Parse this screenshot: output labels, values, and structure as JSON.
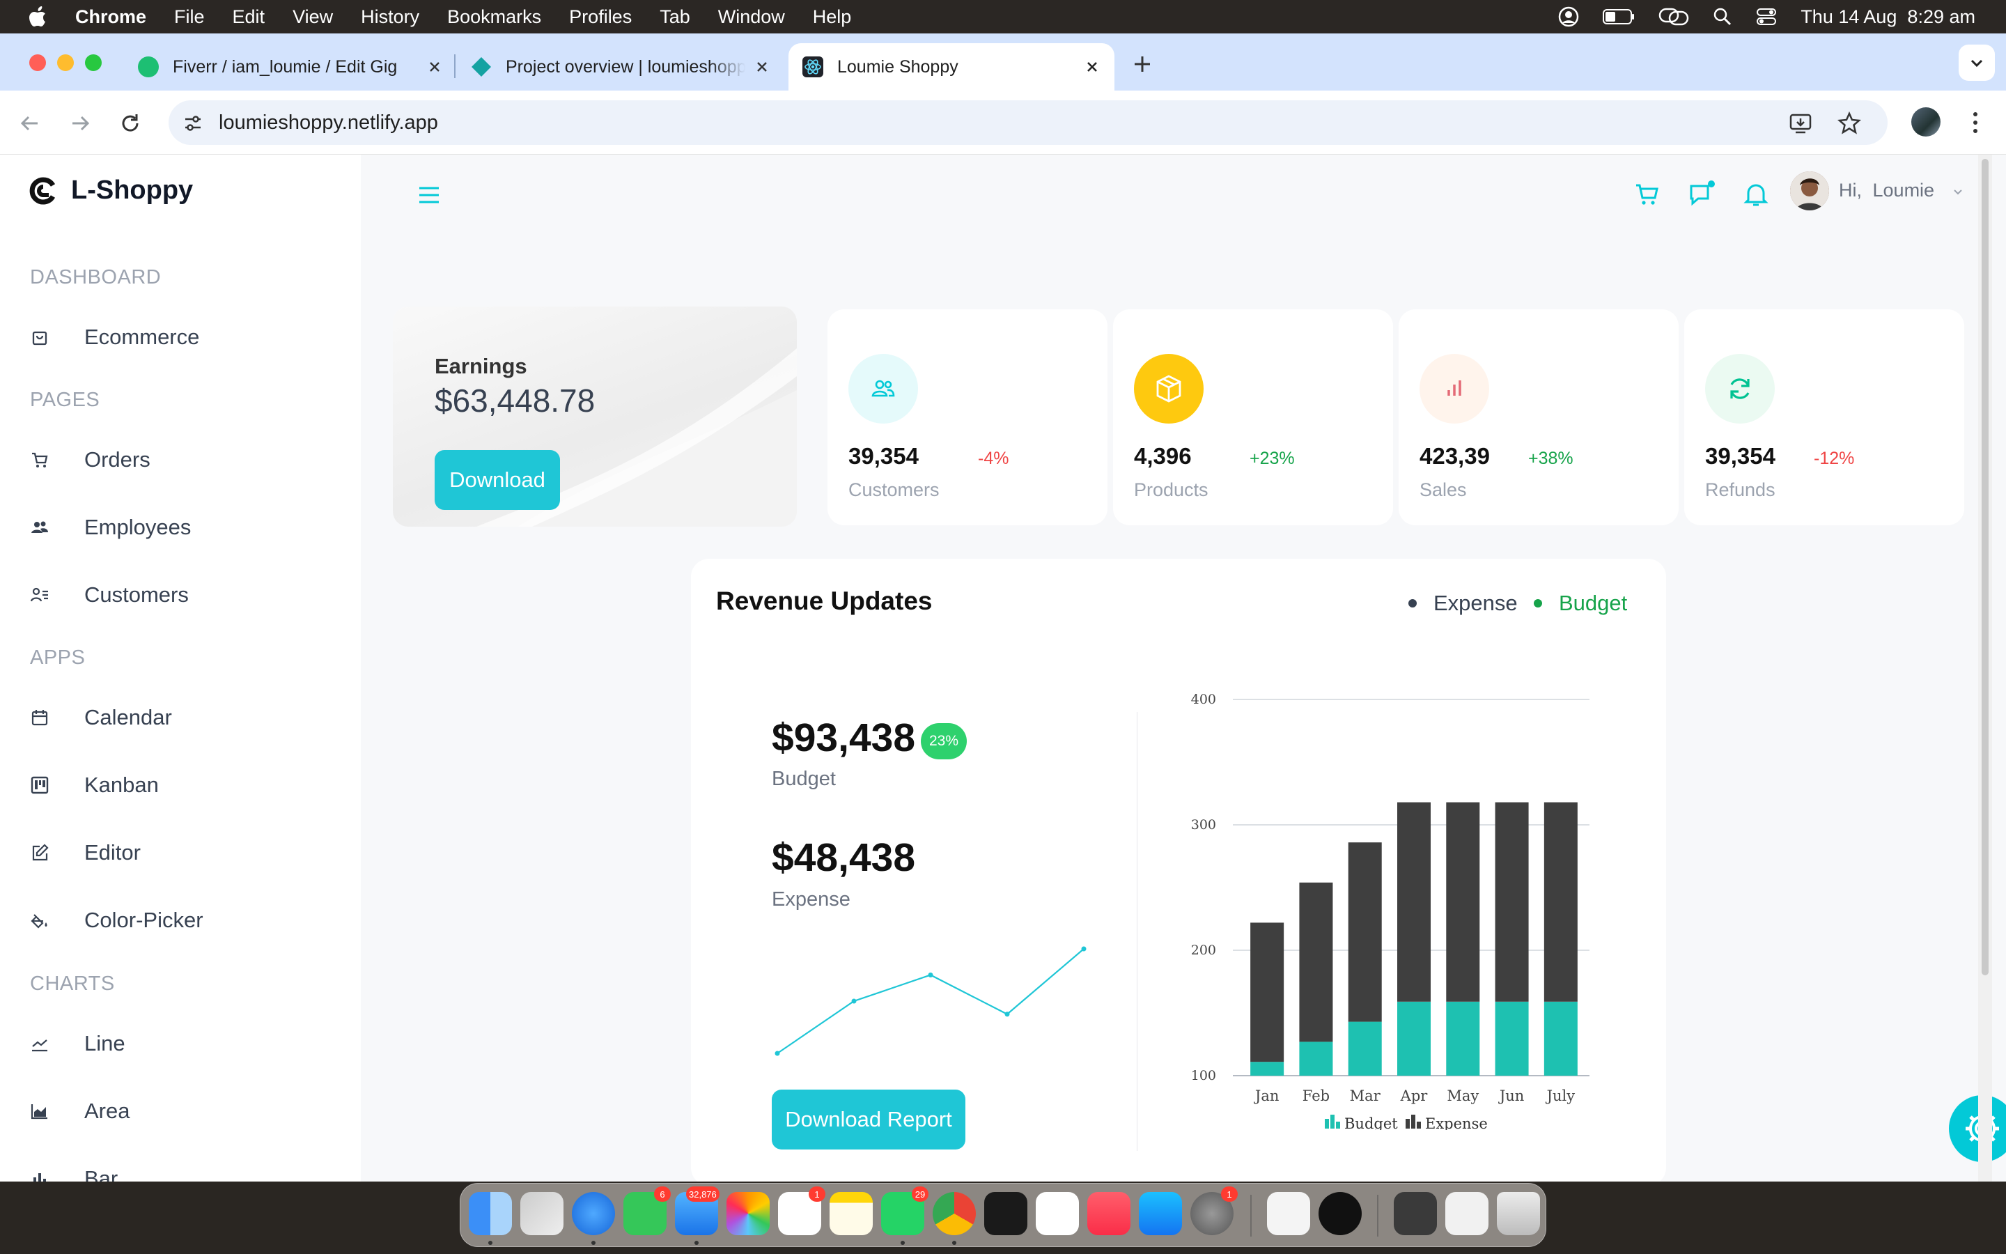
{
  "menubar": {
    "app_name": "Chrome",
    "items": [
      "File",
      "Edit",
      "View",
      "History",
      "Bookmarks",
      "Profiles",
      "Tab",
      "Window",
      "Help"
    ],
    "clock": "Thu 14 Aug  8:29 am"
  },
  "browser": {
    "tabs": [
      {
        "title": "Fiverr / iam_loumie / Edit Gig",
        "favicon_color": "#1dbf73"
      },
      {
        "title": "Project overview | loumieshoppy",
        "favicon_color": "#14a2a2"
      },
      {
        "title": "Loumie Shoppy",
        "favicon_color": "#20232a",
        "active": true
      }
    ],
    "url": "loumieshoppy.netlify.app"
  },
  "sidebar": {
    "brand": "L-Shoppy",
    "sections": [
      {
        "title": "DASHBOARD",
        "items": [
          {
            "label": "Ecommerce",
            "icon": "shopping-bag-icon"
          }
        ]
      },
      {
        "title": "PAGES",
        "items": [
          {
            "label": "Orders",
            "icon": "cart-icon"
          },
          {
            "label": "Employees",
            "icon": "people-icon"
          },
          {
            "label": "Customers",
            "icon": "contact-list-icon"
          }
        ]
      },
      {
        "title": "APPS",
        "items": [
          {
            "label": "Calendar",
            "icon": "calendar-icon"
          },
          {
            "label": "Kanban",
            "icon": "kanban-icon"
          },
          {
            "label": "Editor",
            "icon": "edit-icon"
          },
          {
            "label": "Color-Picker",
            "icon": "paint-bucket-icon"
          }
        ]
      },
      {
        "title": "CHARTS",
        "items": [
          {
            "label": "Line",
            "icon": "line-chart-icon"
          },
          {
            "label": "Area",
            "icon": "area-chart-icon"
          },
          {
            "label": "Bar",
            "icon": "bar-chart-icon"
          }
        ]
      }
    ]
  },
  "header": {
    "greeting_prefix": "Hi,",
    "user_name": "Loumie"
  },
  "earnings": {
    "label": "Earnings",
    "value": "$63,448.78",
    "button": "Download"
  },
  "stats": [
    {
      "value": "39,354",
      "change": "-4%",
      "label": "Customers",
      "icon": "people-icon",
      "icon_color": "#03c9d7",
      "bg": "#e5fafb",
      "change_color": "#ef4444"
    },
    {
      "value": "4,396",
      "change": "+23%",
      "label": "Products",
      "icon": "box-icon",
      "icon_color": "#ffffff",
      "bg": "#fec90f",
      "change_color": "#16a34a"
    },
    {
      "value": "423,39",
      "change": "+38%",
      "label": "Sales",
      "icon": "bar-chart-icon",
      "icon_color": "#e46a76",
      "bg": "#fff4ec",
      "change_color": "#16a34a"
    },
    {
      "value": "39,354",
      "change": "-12%",
      "label": "Refunds",
      "icon": "refresh-icon",
      "icon_color": "#00c292",
      "bg": "#ebfaf2",
      "change_color": "#ef4444"
    }
  ],
  "revenue": {
    "title": "Revenue Updates",
    "legend": [
      {
        "label": "Expense",
        "color": "#374151"
      },
      {
        "label": "Budget",
        "color": "#16a34a"
      }
    ],
    "budget_value": "$93,438",
    "budget_label": "Budget",
    "budget_badge": "23%",
    "expense_value": "$48,438",
    "expense_label": "Expense",
    "sparkline": [
      2,
      6,
      8,
      5,
      10
    ],
    "button": "Download Report"
  },
  "chart_data": {
    "type": "bar",
    "stacked": true,
    "categories": [
      "Jan",
      "Feb",
      "Mar",
      "Apr",
      "May",
      "Jun",
      "July"
    ],
    "series": [
      {
        "name": "Budget",
        "values": [
          111,
          127,
          143,
          159,
          159,
          159,
          159
        ],
        "color": "#1ec1b1"
      },
      {
        "name": "Expense",
        "values": [
          111,
          127,
          143,
          159,
          159,
          159,
          159
        ],
        "color": "#3f3f3f"
      }
    ],
    "ylim": [
      100,
      400
    ],
    "yticks": [
      100,
      200,
      300,
      400
    ],
    "grid": true,
    "legend_position": "bottom"
  },
  "colors": {
    "accent": "#1fc6d6",
    "sidebar_bg": "#ffffff",
    "page_bg": "#f7f8fa"
  },
  "dock": {
    "badges": [
      "6",
      "32,876",
      "1",
      "29",
      "1"
    ]
  }
}
